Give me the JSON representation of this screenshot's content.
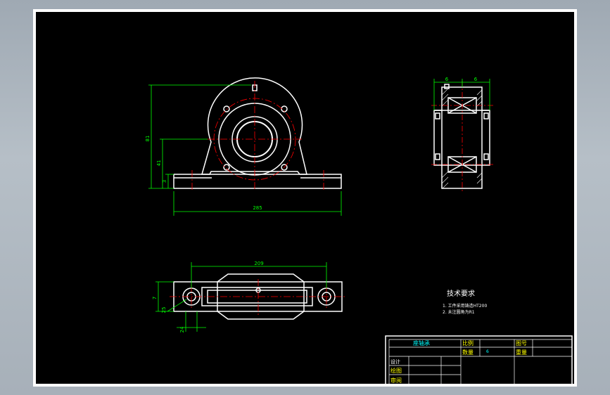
{
  "dimensions": {
    "front_height_total": "81",
    "front_height_center": "41",
    "front_base_thickness": "3",
    "front_width": "285",
    "side_left": "6",
    "side_right": "6",
    "top_length": "209",
    "top_depth": "7",
    "top_slot": "25",
    "top_hole": "24"
  },
  "tech_requirements": {
    "heading": "技术要求",
    "items": [
      "1. 工件采用铸造HT200",
      "2. 未注圆角为R1"
    ]
  },
  "title_block": {
    "part_name": "座轴承",
    "scale_label": "比例",
    "drawing_no_label": "图号",
    "qty_label": "数量",
    "qty_value": "6",
    "weight_label": "重量",
    "design_label": "设计",
    "drawn_label": "绘图",
    "review_label": "审阅"
  },
  "colors": {
    "background": "#000000",
    "outline": "#ffffff",
    "dimension": "#00ff00",
    "centerline": "#ff0000",
    "title_text": "#00ffff",
    "label_text": "#ffff00"
  }
}
